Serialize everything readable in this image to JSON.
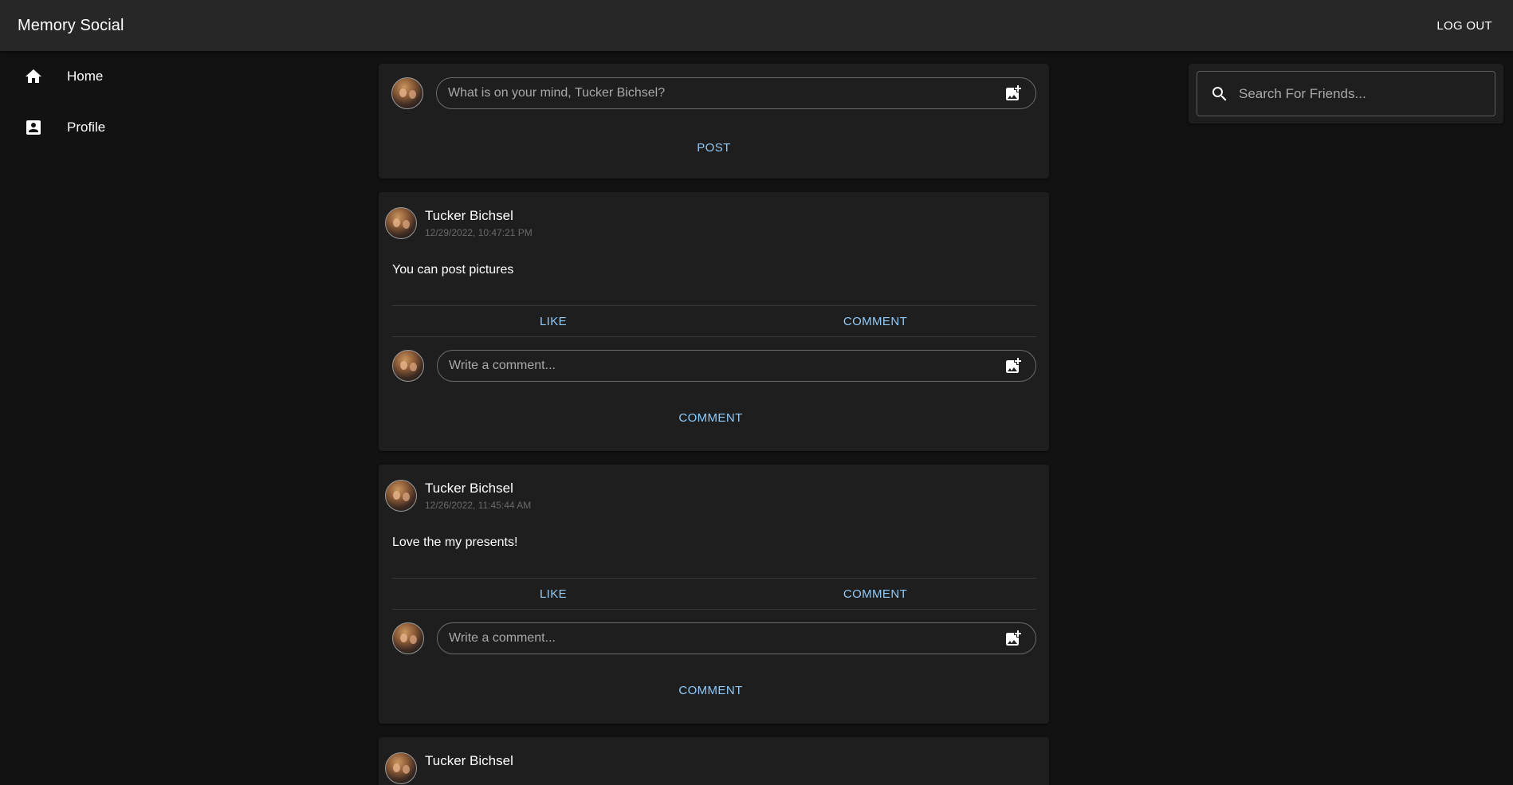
{
  "app": {
    "title": "Memory Social",
    "logout_label": "LOG OUT"
  },
  "sidebar": {
    "items": [
      {
        "label": "Home",
        "icon": "home-icon"
      },
      {
        "label": "Profile",
        "icon": "account-box-icon"
      }
    ]
  },
  "composer": {
    "placeholder": "What is on your mind, Tucker Bichsel?",
    "post_label": "POST",
    "icon": "add-photo-icon"
  },
  "posts": [
    {
      "author": "Tucker Bichsel",
      "timestamp": "12/29/2022, 10:47:21 PM",
      "body": "You can post pictures",
      "like_label": "LIKE",
      "comment_label": "COMMENT",
      "comment_placeholder": "Write a comment...",
      "comment_submit_label": "COMMENT"
    },
    {
      "author": "Tucker Bichsel",
      "timestamp": "12/26/2022, 11:45:44 AM",
      "body": "Love the my presents!",
      "like_label": "LIKE",
      "comment_label": "COMMENT",
      "comment_placeholder": "Write a comment...",
      "comment_submit_label": "COMMENT"
    },
    {
      "author": "Tucker Bichsel"
    }
  ],
  "search": {
    "placeholder": "Search For Friends...",
    "icon": "search-icon"
  },
  "colors": {
    "background": "#121212",
    "surface": "#1e1e1e",
    "appbar": "#272727",
    "accent": "#90caf9"
  }
}
